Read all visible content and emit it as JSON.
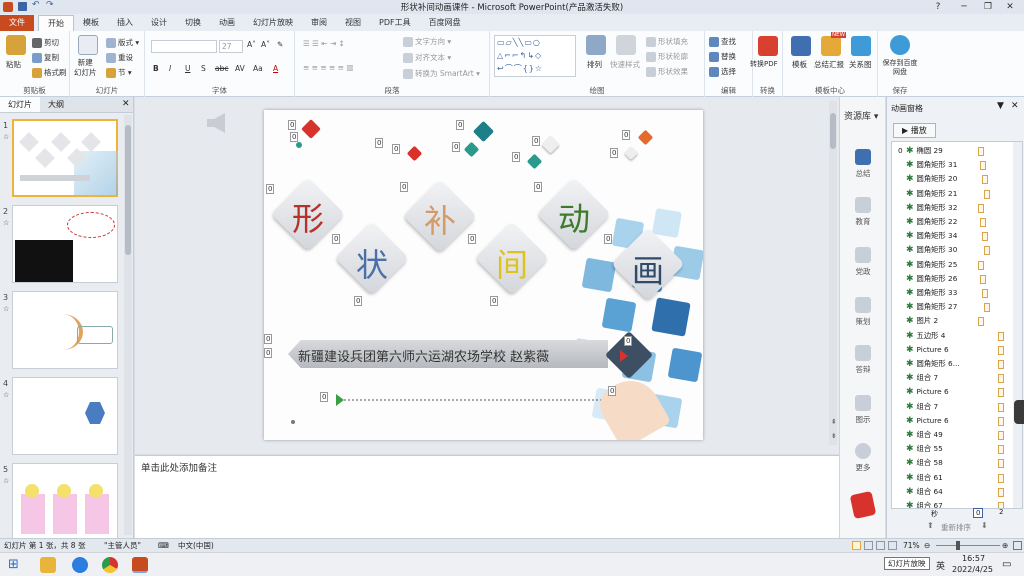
{
  "window": {
    "title": "形状补间动画课件 - Microsoft PowerPoint(产品激活失败)",
    "controls": [
      "?",
      "─",
      "❐",
      "✕"
    ]
  },
  "ribbon_tabs": [
    "文件",
    "开始",
    "模板",
    "插入",
    "设计",
    "切换",
    "动画",
    "幻灯片放映",
    "审阅",
    "视图",
    "PDF工具",
    "百度网盘"
  ],
  "ribbon": {
    "clipboard": {
      "paste": "粘贴",
      "cut": "剪切",
      "copy": "复制",
      "format_painter": "格式刷",
      "label": "剪贴板"
    },
    "slides": {
      "new_slide": "新建\n幻灯片",
      "layout": "版式",
      "reset": "重设",
      "section": "节",
      "label": "幻灯片"
    },
    "font": {
      "font_size": "27",
      "label": "字体",
      "buttons": [
        "B",
        "I",
        "U",
        "S",
        "abc",
        "AV",
        "Aa",
        "A"
      ]
    },
    "paragraph": {
      "text_direction": "文字方向",
      "align_text": "对齐文本",
      "smartart": "转换为 SmartArt",
      "label": "段落"
    },
    "drawing": {
      "arrange": "排列",
      "quick_styles": "快速样式",
      "shape_fill": "形状填充",
      "shape_outline": "形状轮廓",
      "shape_effects": "形状效果",
      "label": "绘图"
    },
    "editing": {
      "find": "查找",
      "replace": "替换",
      "select": "选择",
      "label": "编辑"
    },
    "convert": {
      "to_pdf": "转换PDF",
      "label": "转换"
    },
    "templates": {
      "template": "模板",
      "report": "总结汇报",
      "diagram": "关系图",
      "badge": "NEW",
      "label": "模板中心"
    },
    "save": {
      "save_baidu": "保存到百度网盘",
      "label": "保存"
    }
  },
  "left_pane": {
    "tabs": [
      "幻灯片",
      "大纲"
    ],
    "slides": [
      {
        "num": "1",
        "star": "☆"
      },
      {
        "num": "2",
        "star": "☆"
      },
      {
        "num": "3",
        "star": "☆"
      },
      {
        "num": "4",
        "star": "☆"
      },
      {
        "num": "5",
        "star": "☆"
      }
    ]
  },
  "slide": {
    "chars": [
      "形",
      "状",
      "补",
      "间",
      "动",
      "画"
    ],
    "subtitle": "新疆建设兵团第六师六运湖农场学校  赵紫薇",
    "anim_tag": "0"
  },
  "notes": {
    "placeholder": "单击此处添加备注"
  },
  "resource_sidebar": {
    "header": "资源库",
    "items": [
      "总结",
      "教育",
      "党政",
      "策划",
      "答辩",
      "图示",
      "更多"
    ]
  },
  "animation_pane": {
    "title": "动画窗格",
    "play": "▶ 播放",
    "items": [
      {
        "num": "0",
        "name": "椭圆 29"
      },
      {
        "num": "",
        "name": "圆角矩形 31"
      },
      {
        "num": "",
        "name": "圆角矩形 20"
      },
      {
        "num": "",
        "name": "圆角矩形 21"
      },
      {
        "num": "",
        "name": "圆角矩形 32"
      },
      {
        "num": "",
        "name": "圆角矩形 22"
      },
      {
        "num": "",
        "name": "圆角矩形 34"
      },
      {
        "num": "",
        "name": "圆角矩形 30"
      },
      {
        "num": "",
        "name": "圆角矩形 25"
      },
      {
        "num": "",
        "name": "圆角矩形 26"
      },
      {
        "num": "",
        "name": "圆角矩形 33"
      },
      {
        "num": "",
        "name": "圆角矩形 27"
      },
      {
        "num": "",
        "name": "图片 2"
      },
      {
        "num": "",
        "name": "五边形 4"
      },
      {
        "num": "",
        "name": "Picture 6"
      },
      {
        "num": "",
        "name": "圆角矩形 6..."
      },
      {
        "num": "",
        "name": "组合 7"
      },
      {
        "num": "",
        "name": "Picture 6"
      },
      {
        "num": "",
        "name": "组合 7"
      },
      {
        "num": "",
        "name": "Picture 6"
      },
      {
        "num": "",
        "name": "组合 49"
      },
      {
        "num": "",
        "name": "组合 55"
      },
      {
        "num": "",
        "name": "组合 58"
      },
      {
        "num": "",
        "name": "组合 61"
      },
      {
        "num": "",
        "name": "组合 64"
      },
      {
        "num": "",
        "name": "组合 67"
      }
    ],
    "timeline_label": "秒",
    "timeline_start": "0",
    "timeline_end": "2",
    "reorder": "重新排序"
  },
  "status": {
    "slide_info": "幻灯片 第 1 张，共 8 张",
    "theme": "\"主管人员\"",
    "language": "中文(中国)",
    "zoom": "71%",
    "tooltip": "幻灯片放映"
  },
  "taskbar": {
    "time": "16:57",
    "date": "2022/4/25",
    "ime": "英"
  },
  "colors": {
    "file_tab": "#c84b1f",
    "accent": "#2b579a"
  }
}
